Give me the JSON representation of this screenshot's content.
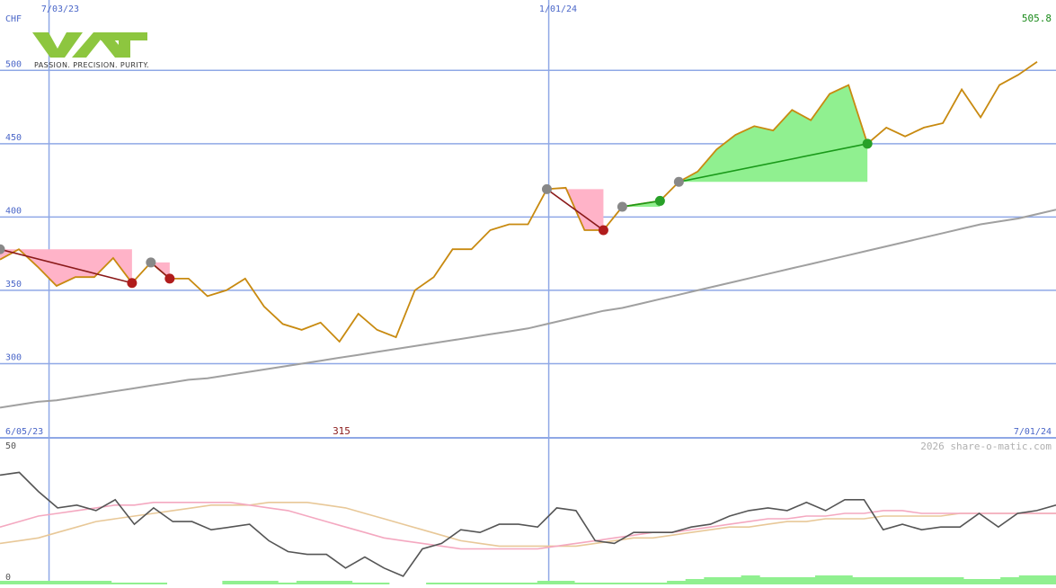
{
  "chart_data": [
    {
      "type": "line",
      "currency": "CHF",
      "last_value_label": "505.8",
      "low_marker_label": "315",
      "start_date_label": "6/05/23",
      "end_date_label": "7/01/24",
      "top_date_labels": [
        "7/03/23",
        "1/01/24"
      ],
      "y_ticks": [
        300,
        350,
        400,
        450,
        500
      ],
      "ylim": [
        250,
        548
      ],
      "x_count": 57,
      "vertical_gridlines_at": [
        2.6,
        29.1
      ],
      "colors": {
        "price": "#c88a10",
        "ma": "#a0a0a0",
        "grid": "#8fa8e6",
        "loss_fill": "#ffb3c8",
        "gain_fill": "#90f090",
        "gain_line": "#1a9a1a",
        "loss_line": "#8b1a1a",
        "label_blue": "#4a66c8",
        "label_green": "#1a8a1a",
        "label_brown": "#8b1a1a"
      },
      "series": [
        {
          "role": "price",
          "values": [
            371,
            378,
            366,
            353,
            359,
            359,
            372,
            355,
            369,
            358,
            358,
            346,
            350,
            358,
            339,
            327,
            323,
            328,
            315,
            334,
            323,
            318,
            350,
            359,
            378,
            378,
            391,
            395,
            395,
            419,
            420,
            391,
            391,
            407,
            409,
            411,
            424,
            431,
            446,
            456,
            462,
            459,
            473,
            466,
            484,
            490,
            450,
            461,
            455,
            461,
            464,
            487,
            468,
            490,
            497,
            505.8
          ]
        },
        {
          "role": "moving-average",
          "values": [
            270,
            272,
            274,
            275,
            277,
            279,
            281,
            283,
            285,
            287,
            289,
            290,
            292,
            294,
            296,
            298,
            300,
            302,
            304,
            306,
            308,
            310,
            312,
            314,
            316,
            318,
            320,
            322,
            324,
            327,
            330,
            333,
            336,
            338,
            341,
            344,
            347,
            350,
            353,
            356,
            359,
            362,
            365,
            368,
            371,
            374,
            377,
            380,
            383,
            386,
            389,
            392,
            395,
            397,
            399,
            402,
            405
          ]
        }
      ],
      "trades": [
        {
          "kind": "loss",
          "entry_index": 0,
          "entry_value": 378,
          "exit_index": 7,
          "exit_value": 355
        },
        {
          "kind": "loss",
          "entry_index": 8,
          "entry_value": 369,
          "exit_index": 9,
          "exit_value": 358
        },
        {
          "kind": "loss",
          "entry_index": 29,
          "entry_value": 419,
          "exit_index": 32,
          "exit_value": 391
        },
        {
          "kind": "gain",
          "entry_index": 33,
          "entry_value": 407,
          "exit_index": 35,
          "exit_value": 411
        },
        {
          "kind": "gain",
          "entry_index": 36,
          "entry_value": 424,
          "exit_index": 46,
          "exit_value": 450
        }
      ]
    },
    {
      "type": "line",
      "ylim": [
        0,
        50
      ],
      "y_ticks": [
        0,
        50
      ],
      "copyright": "2026 share-o-matic.com",
      "series": [
        {
          "role": "oscillator",
          "values": [
            40,
            41,
            34,
            28,
            29,
            27,
            31,
            22,
            28,
            23,
            23,
            20,
            21,
            22,
            16,
            12,
            11,
            11,
            6,
            10,
            6,
            3,
            13,
            15,
            20,
            19,
            22,
            22,
            21,
            28,
            27,
            16,
            15,
            19,
            19,
            19,
            21,
            22,
            25,
            27,
            28,
            27,
            30,
            27,
            31,
            31,
            20,
            22,
            20,
            21,
            21,
            26,
            21,
            26,
            27,
            29
          ]
        },
        {
          "role": "signal-fast",
          "values": [
            21,
            23,
            25,
            26,
            27,
            28,
            29,
            29,
            30,
            30,
            30,
            30,
            30,
            29,
            28,
            27,
            25,
            23,
            21,
            19,
            17,
            16,
            15,
            14,
            13,
            13,
            13,
            13,
            13,
            14,
            15,
            16,
            17,
            18,
            19,
            19,
            20,
            21,
            22,
            23,
            24,
            24,
            25,
            25,
            26,
            26,
            27,
            27,
            26,
            26,
            26,
            26,
            26,
            26,
            26,
            26
          ]
        },
        {
          "role": "signal-slow",
          "values": [
            15,
            16,
            17,
            19,
            21,
            23,
            24,
            25,
            26,
            27,
            28,
            29,
            29,
            29,
            30,
            30,
            30,
            29,
            28,
            26,
            24,
            22,
            20,
            18,
            16,
            15,
            14,
            14,
            14,
            14,
            14,
            15,
            16,
            17,
            17,
            18,
            19,
            20,
            21,
            21,
            22,
            23,
            23,
            24,
            24,
            24,
            25,
            25,
            25,
            25,
            26,
            26,
            26,
            26,
            26,
            26
          ]
        }
      ],
      "volume": [
        2,
        2,
        2,
        2,
        2,
        2,
        1,
        1,
        1,
        0,
        0,
        0,
        2,
        2,
        2,
        1,
        2,
        2,
        2,
        1,
        1,
        0,
        0,
        1,
        1,
        1,
        1,
        1,
        1,
        2,
        2,
        1,
        1,
        1,
        1,
        1,
        2,
        3,
        4,
        4,
        5,
        4,
        4,
        4,
        5,
        5,
        4,
        4,
        4,
        4,
        4,
        4,
        3,
        3,
        4,
        5,
        5
      ]
    }
  ]
}
